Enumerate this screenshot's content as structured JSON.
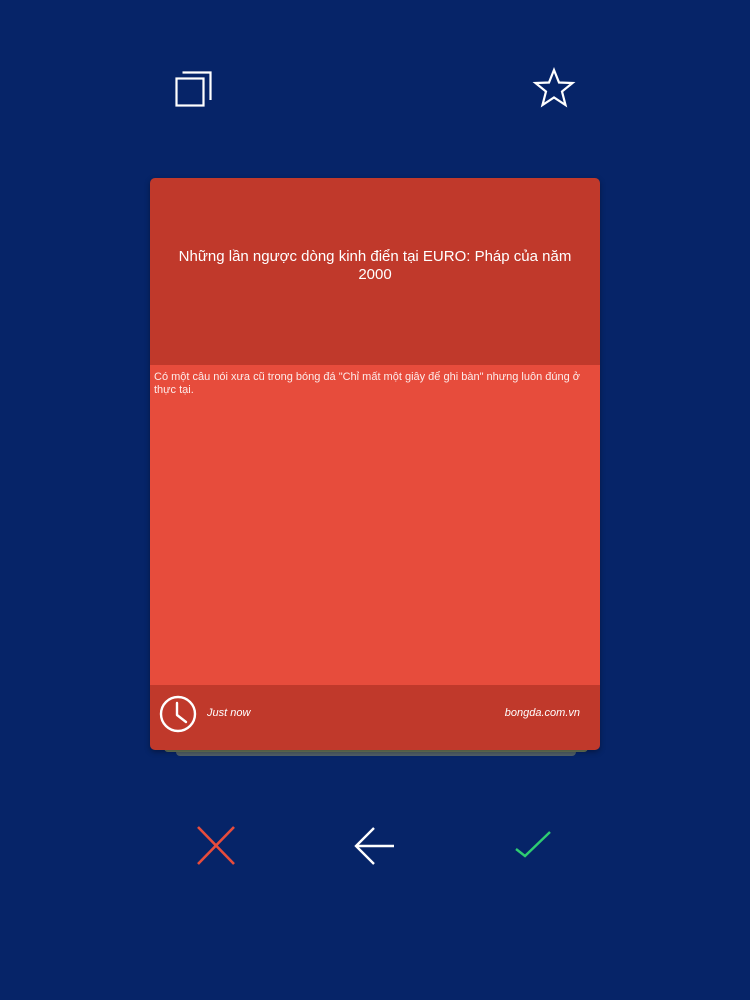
{
  "toolbar": {
    "copy_icon": "copy-icon",
    "favorite_icon": "star-icon"
  },
  "card": {
    "title": "Những lần ngược dòng kinh điển tại EURO: Pháp của năm 2000",
    "excerpt": "Có một câu nói xưa cũ trong bóng đá \"Chỉ mất một giây để ghi bàn\" nhưng luôn đúng ở thực tại.",
    "time": "Just now",
    "source": "bongda.com.vn",
    "header_color": "#c0392b",
    "body_color": "#e74c3c"
  },
  "actions": {
    "reject_icon": "close-icon",
    "back_icon": "arrow-left-icon",
    "accept_icon": "check-icon",
    "reject_color": "#e74c3c",
    "accept_color": "#2ecc71"
  },
  "background_color": "#062468"
}
